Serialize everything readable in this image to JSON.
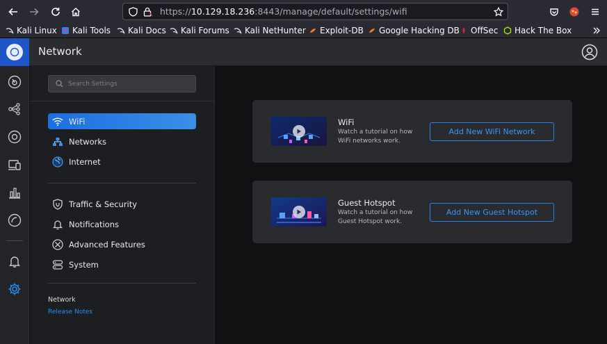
{
  "browser": {
    "url_prefix": "https://",
    "url_host": "10.129.18.236",
    "url_rest": ":8443/manage/default/settings/wifi",
    "bookmarks": [
      {
        "label": "Kali Linux",
        "icon": "kali-dragon-icon"
      },
      {
        "label": "Kali Tools",
        "icon": "kali-tools-icon"
      },
      {
        "label": "Kali Docs",
        "icon": "kali-dragon-icon"
      },
      {
        "label": "Kali Forums",
        "icon": "kali-dragon-icon"
      },
      {
        "label": "Kali NetHunter",
        "icon": "kali-dragon-icon"
      },
      {
        "label": "Exploit-DB",
        "icon": "exploit-db-icon"
      },
      {
        "label": "Google Hacking DB",
        "icon": "exploit-db-icon"
      },
      {
        "label": "OffSec",
        "icon": "offsec-icon"
      },
      {
        "label": "Hack The Box",
        "icon": "htb-cube-icon"
      }
    ]
  },
  "header": {
    "title": "Network"
  },
  "settings": {
    "search_placeholder": "Search Settings",
    "menu": [
      {
        "label": "WiFi",
        "icon": "wifi-icon",
        "active": true
      },
      {
        "label": "Networks",
        "icon": "networks-icon"
      },
      {
        "label": "Internet",
        "icon": "globe-icon"
      },
      {
        "label": "Traffic & Security",
        "icon": "shield-icon"
      },
      {
        "label": "Notifications",
        "icon": "bell-icon"
      },
      {
        "label": "Advanced Features",
        "icon": "tools-icon"
      },
      {
        "label": "System",
        "icon": "server-icon"
      }
    ],
    "footer_title": "Network",
    "footer_link": "Release Notes"
  },
  "cards": [
    {
      "title": "WiFi",
      "description": "Watch a tutorial on how WiFi networks work.",
      "button": "Add New WiFi Network"
    },
    {
      "title": "Guest Hotspot",
      "description": "Watch a tutorial on how Guest Hotspot work.",
      "button": "Add New Guest Hotspot"
    }
  ],
  "colors": {
    "accent": "#2a7fe8",
    "brand": "#1e55c9",
    "active_menu": "#1b6fe0"
  }
}
